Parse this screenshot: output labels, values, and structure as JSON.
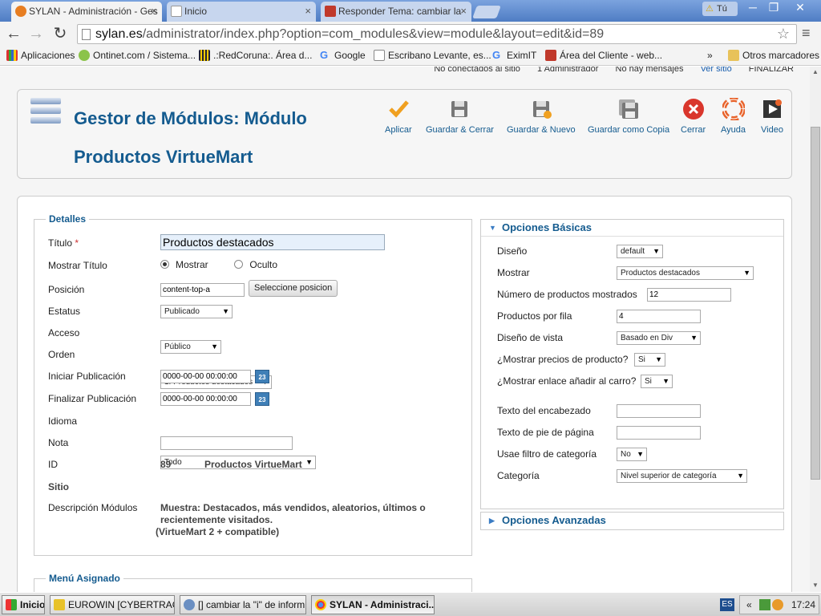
{
  "browser": {
    "tabs": [
      {
        "title": "SYLAN - Administración - Ges",
        "active": true,
        "icon": "joomla-icon"
      },
      {
        "title": "Inicio",
        "active": false,
        "icon": "page-icon"
      },
      {
        "title": "Responder Tema: cambiar la",
        "active": false,
        "icon": "forum-icon"
      }
    ],
    "user_badge": "Tú",
    "url_host": "sylan.es",
    "url_path": "/administrator/index.php?option=com_modules&view=module&layout=edit&id=89",
    "bookmarks": [
      "Aplicaciones",
      "Ontinet.com / Sistema...",
      ".:RedCoruna:. Área d...",
      "Google",
      "Escribano Levante, es...",
      "EximIT",
      "Área del Cliente - web..."
    ],
    "bookmarks_more": "»",
    "other_bookmarks": "Otros marcadores"
  },
  "status_bar": {
    "offline": "No conectados al sitio",
    "admins": "1 Administrador",
    "messages": "No hay mensajes",
    "view_site": "Ver sitio",
    "logout": "FINALIZAR"
  },
  "header": {
    "title": "Gestor de Módulos: Módulo Productos VirtueMart",
    "buttons": [
      {
        "label": "Aplicar",
        "icon": "check-icon"
      },
      {
        "label": "Guardar & Cerrar",
        "icon": "floppy-icon"
      },
      {
        "label": "Guardar & Nuevo",
        "icon": "floppy-new-icon"
      },
      {
        "label": "Guardar como Copia",
        "icon": "floppy-copy-icon"
      },
      {
        "label": "Cerrar",
        "icon": "close-icon"
      },
      {
        "label": "Ayuda",
        "icon": "help-icon"
      },
      {
        "label": "Video",
        "icon": "video-icon"
      }
    ]
  },
  "details": {
    "legend": "Detalles",
    "title_label": "Título",
    "title_required": "*",
    "title_value": "Productos destacados",
    "show_title_label": "Mostrar Título",
    "show_option": "Mostrar",
    "hide_option": "Oculto",
    "position_label": "Posición",
    "position_value": "content-top-a",
    "position_button": "Seleccione posicion",
    "status_label": "Estatus",
    "status_value": "Publicado",
    "access_label": "Acceso",
    "access_value": "Público",
    "order_label": "Orden",
    "order_value": "1. Productos destacados",
    "start_label": "Iniciar Publicación",
    "start_value": "0000-00-00 00:00:00",
    "finish_label": "Finalizar Publicación",
    "finish_value": "0000-00-00 00:00:00",
    "calendar_text": "23",
    "language_label": "Idioma",
    "language_value": "Todo",
    "note_label": "Nota",
    "note_value": "",
    "id_label": "ID",
    "id_value": "89",
    "module_type": "Productos VirtueMart",
    "site_label": "Sitio",
    "desc_label": "Descripción Módulos",
    "desc_line1": "Muestra: Destacados, más vendidos, aleatorios, últimos o",
    "desc_line2": "recientemente visitados.",
    "desc_line3": "(VirtueMart 2 + compatible)"
  },
  "menu_assigned": {
    "legend": "Menú Asignado"
  },
  "basic_options": {
    "header": "Opciones Básicas",
    "layout_label": "Diseño",
    "layout_value": "default",
    "show_label": "Mostrar",
    "show_value": "Productos destacados",
    "count_label": "Número de productos mostrados",
    "count_value": "12",
    "per_row_label": "Productos por fila",
    "per_row_value": "4",
    "view_label": "Diseño de vista",
    "view_value": "Basado en Div",
    "prices_label": "¿Mostrar precios de producto?",
    "prices_value": "Si",
    "cart_label": "¿Mostrar enlace añadir al carro?",
    "cart_value": "Si",
    "header_text_label": "Texto del encabezado",
    "header_text_value": "",
    "footer_text_label": "Texto de pie de página",
    "footer_text_value": "",
    "cat_filter_label": "Usae filtro de categoría",
    "cat_filter_value": "No",
    "category_label": "Categoría",
    "category_value": "Nivel superior de categoría"
  },
  "advanced_options": {
    "header": "Opciones Avanzadas"
  },
  "taskbar": {
    "start": "Inicio",
    "items": [
      "EUROWIN [CYBERTRAC...",
      "[] cambiar la \"i\" de inform...",
      "SYLAN - Administraci..."
    ],
    "lang": "ES",
    "tray_chevron": "«",
    "clock": "17:24"
  }
}
